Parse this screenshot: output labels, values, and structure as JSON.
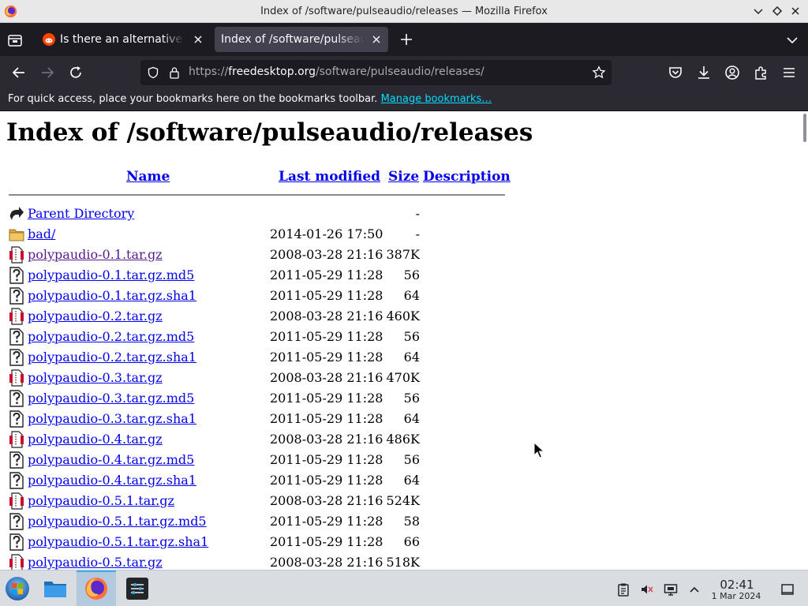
{
  "window": {
    "title": "Index of /software/pulseaudio/releases — Mozilla Firefox"
  },
  "tabs": [
    {
      "title": "Is there an alternative to",
      "favicon": "reddit-icon",
      "active": false
    },
    {
      "title": "Index of /software/pulseaudio/releases",
      "active": true
    }
  ],
  "navbar": {
    "url_prefix": "https://",
    "url_host": "freedesktop.org",
    "url_path": "/software/pulseaudio/releases/"
  },
  "bookmarks_bar": {
    "message": "For quick access, place your bookmarks here on the bookmarks toolbar.",
    "link": "Manage bookmarks…"
  },
  "page": {
    "heading": "Index of /software/pulseaudio/releases",
    "columns": {
      "name": "Name",
      "modified": "Last modified",
      "size": "Size",
      "description": "Description"
    },
    "rows": [
      {
        "icon": "back-icon",
        "name": "Parent Directory",
        "modified": "",
        "size": "-"
      },
      {
        "icon": "folder-icon",
        "name": "bad/",
        "modified": "2014-01-26 17:50",
        "size": "-"
      },
      {
        "icon": "archive-icon",
        "name": "polypaudio-0.1.tar.gz",
        "modified": "2008-03-28 21:16",
        "size": "387K",
        "visited": true
      },
      {
        "icon": "unknown-file-icon",
        "name": "polypaudio-0.1.tar.gz.md5",
        "modified": "2011-05-29 11:28",
        "size": "56"
      },
      {
        "icon": "unknown-file-icon",
        "name": "polypaudio-0.1.tar.gz.sha1",
        "modified": "2011-05-29 11:28",
        "size": "64"
      },
      {
        "icon": "archive-icon",
        "name": "polypaudio-0.2.tar.gz",
        "modified": "2008-03-28 21:16",
        "size": "460K"
      },
      {
        "icon": "unknown-file-icon",
        "name": "polypaudio-0.2.tar.gz.md5",
        "modified": "2011-05-29 11:28",
        "size": "56"
      },
      {
        "icon": "unknown-file-icon",
        "name": "polypaudio-0.2.tar.gz.sha1",
        "modified": "2011-05-29 11:28",
        "size": "64"
      },
      {
        "icon": "archive-icon",
        "name": "polypaudio-0.3.tar.gz",
        "modified": "2008-03-28 21:16",
        "size": "470K"
      },
      {
        "icon": "unknown-file-icon",
        "name": "polypaudio-0.3.tar.gz.md5",
        "modified": "2011-05-29 11:28",
        "size": "56"
      },
      {
        "icon": "unknown-file-icon",
        "name": "polypaudio-0.3.tar.gz.sha1",
        "modified": "2011-05-29 11:28",
        "size": "64"
      },
      {
        "icon": "archive-icon",
        "name": "polypaudio-0.4.tar.gz",
        "modified": "2008-03-28 21:16",
        "size": "486K"
      },
      {
        "icon": "unknown-file-icon",
        "name": "polypaudio-0.4.tar.gz.md5",
        "modified": "2011-05-29 11:28",
        "size": "56"
      },
      {
        "icon": "unknown-file-icon",
        "name": "polypaudio-0.4.tar.gz.sha1",
        "modified": "2011-05-29 11:28",
        "size": "64"
      },
      {
        "icon": "archive-icon",
        "name": "polypaudio-0.5.1.tar.gz",
        "modified": "2008-03-28 21:16",
        "size": "524K"
      },
      {
        "icon": "unknown-file-icon",
        "name": "polypaudio-0.5.1.tar.gz.md5",
        "modified": "2011-05-29 11:28",
        "size": "58"
      },
      {
        "icon": "unknown-file-icon",
        "name": "polypaudio-0.5.1.tar.gz.sha1",
        "modified": "2011-05-29 11:28",
        "size": "66"
      },
      {
        "icon": "archive-icon",
        "name": "polypaudio-0.5.tar.gz",
        "modified": "2008-03-28 21:16",
        "size": "518K"
      }
    ]
  },
  "taskbar": {
    "time": "02:41",
    "date": "1 Mar 2024",
    "apps": [
      "start-menu-icon",
      "file-manager-icon",
      "firefox-icon",
      "settings-icon"
    ],
    "tray": [
      "clipboard-icon",
      "volume-muted-icon",
      "display-icon",
      "tray-expand-icon",
      "show-desktop-icon"
    ]
  },
  "colors": {
    "link": "#0000ee",
    "visited_link": "#551a8b",
    "toolbar_bg": "#2b2a33",
    "tabstrip_bg": "#1c1b22",
    "accent": "#00ddff"
  }
}
